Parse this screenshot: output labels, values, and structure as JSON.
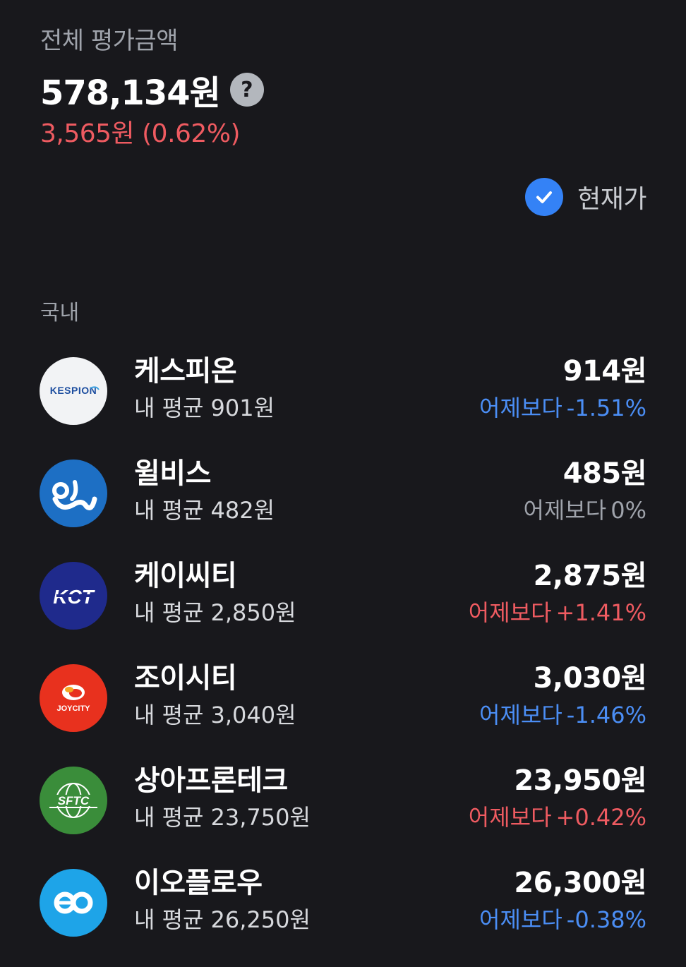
{
  "summary": {
    "label": "전체 평가금액",
    "total": "578,134원",
    "help_icon": "?",
    "change": "3,565원 (0.62%)",
    "change_color": "#ef5b61"
  },
  "price_toggle": {
    "label": "현재가",
    "checked": true,
    "accent": "#3482f6"
  },
  "section": {
    "title": "국내"
  },
  "stocks": [
    {
      "name": "케스피온",
      "avg_label": "내 평균",
      "avg": "901원",
      "price": "914원",
      "change_label": "어제보다",
      "change": "-1.51%",
      "direction": "down",
      "logo": {
        "icon": "kespion-logo",
        "text": "KESPION",
        "bg": "#f2f3f5"
      }
    },
    {
      "name": "윌비스",
      "avg_label": "내 평균",
      "avg": "482원",
      "price": "485원",
      "change_label": "어제보다",
      "change": "0%",
      "direction": "flat",
      "logo": {
        "icon": "willbes-logo",
        "bg": "#1d6fc4"
      }
    },
    {
      "name": "케이씨티",
      "avg_label": "내 평균",
      "avg": "2,850원",
      "price": "2,875원",
      "change_label": "어제보다",
      "change": "+1.41%",
      "direction": "up",
      "logo": {
        "icon": "kct-logo",
        "text": "KCT",
        "bg": "#1f2a8c"
      }
    },
    {
      "name": "조이시티",
      "avg_label": "내 평균",
      "avg": "3,040원",
      "price": "3,030원",
      "change_label": "어제보다",
      "change": "-1.46%",
      "direction": "down",
      "logo": {
        "icon": "joycity-logo",
        "text": "JOYCITY",
        "bg": "#e8311e"
      }
    },
    {
      "name": "상아프론테크",
      "avg_label": "내 평균",
      "avg": "23,750원",
      "price": "23,950원",
      "change_label": "어제보다",
      "change": "+0.42%",
      "direction": "up",
      "logo": {
        "icon": "sftc-logo",
        "text": "SFTC",
        "bg": "#3a8d3a"
      }
    },
    {
      "name": "이오플로우",
      "avg_label": "내 평균",
      "avg": "26,250원",
      "price": "26,300원",
      "change_label": "어제보다",
      "change": "-0.38%",
      "direction": "down",
      "logo": {
        "icon": "eoflow-logo",
        "bg": "#1ea4e8"
      }
    }
  ],
  "colors": {
    "background": "#18181c",
    "up": "#ef5b61",
    "down": "#4b8ef5",
    "flat": "#9fa3ab"
  }
}
